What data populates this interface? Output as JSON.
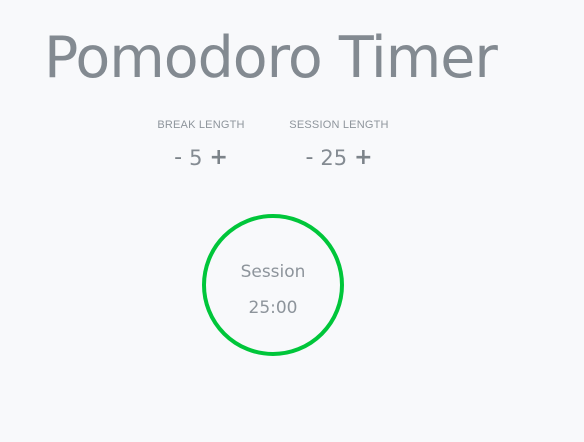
{
  "app": {
    "title": "Pomodoro Timer"
  },
  "break": {
    "label": "BREAK LENGTH",
    "decrement": "-",
    "value": "5",
    "increment": "+"
  },
  "session": {
    "label": "SESSION LENGTH",
    "decrement": "-",
    "value": "25",
    "increment": "+"
  },
  "timer": {
    "mode": "Session",
    "time": "25:00",
    "ring_color": "#00c63a"
  },
  "colors": {
    "background": "#f8f9fb",
    "text": "#838a91",
    "accent": "#00c63a"
  }
}
